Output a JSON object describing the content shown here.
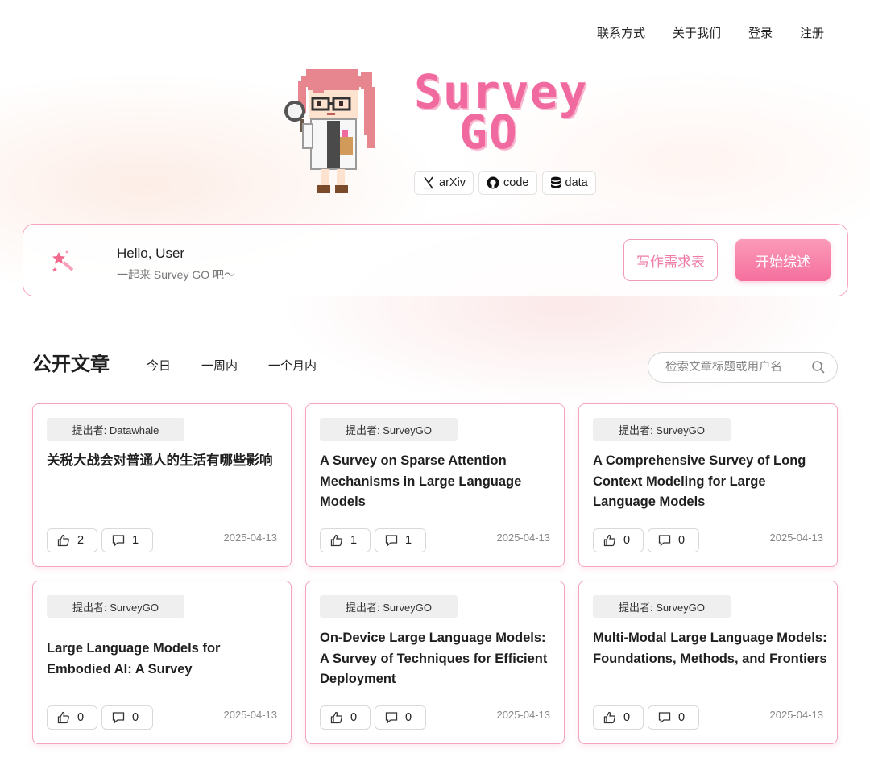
{
  "nav": {
    "items": [
      "联系方式",
      "关于我们",
      "登录",
      "注册"
    ]
  },
  "logo": {
    "line1": "Survey",
    "line2": "GO"
  },
  "links": [
    {
      "label": "arXiv",
      "icon": "arxiv-icon"
    },
    {
      "label": "code",
      "icon": "github-icon"
    },
    {
      "label": "data",
      "icon": "database-icon"
    }
  ],
  "hello": {
    "title": "Hello, User",
    "subtitle": "一起来 Survey GO 吧～",
    "form_button": "写作需求表",
    "start_button": "开始综述"
  },
  "section": {
    "title": "公开文章",
    "filters": [
      "今日",
      "一周内",
      "一个月内"
    ],
    "search_placeholder": "检索文章标题或用户名"
  },
  "articles": [
    {
      "submitter": "提出者: Datawhale",
      "title": "关税大战会对普通人的生活有哪些影响",
      "likes": "2",
      "comments": "1",
      "date": "2025-04-13"
    },
    {
      "submitter": "提出者: SurveyGO",
      "title": "A Survey on Sparse Attention Mechanisms in Large Language Models",
      "likes": "1",
      "comments": "1",
      "date": "2025-04-13"
    },
    {
      "submitter": "提出者: SurveyGO",
      "title": "A Comprehensive Survey of Long Context Modeling for Large Language Models",
      "likes": "0",
      "comments": "0",
      "date": "2025-04-13"
    },
    {
      "submitter": "提出者: SurveyGO",
      "title": "Large Language Models for Embodied AI: A Survey",
      "likes": "0",
      "comments": "0",
      "date": "2025-04-13"
    },
    {
      "submitter": "提出者: SurveyGO",
      "title": "On-Device Large Language Models: A Survey of Techniques for Efficient Deployment",
      "likes": "0",
      "comments": "0",
      "date": "2025-04-13"
    },
    {
      "submitter": "提出者: SurveyGO",
      "title": "Multi-Modal Large Language Models: Foundations, Methods, and Frontiers",
      "likes": "0",
      "comments": "0",
      "date": "2025-04-13"
    }
  ],
  "colors": {
    "accent": "#f06aa0",
    "border": "#f4a4bd"
  }
}
